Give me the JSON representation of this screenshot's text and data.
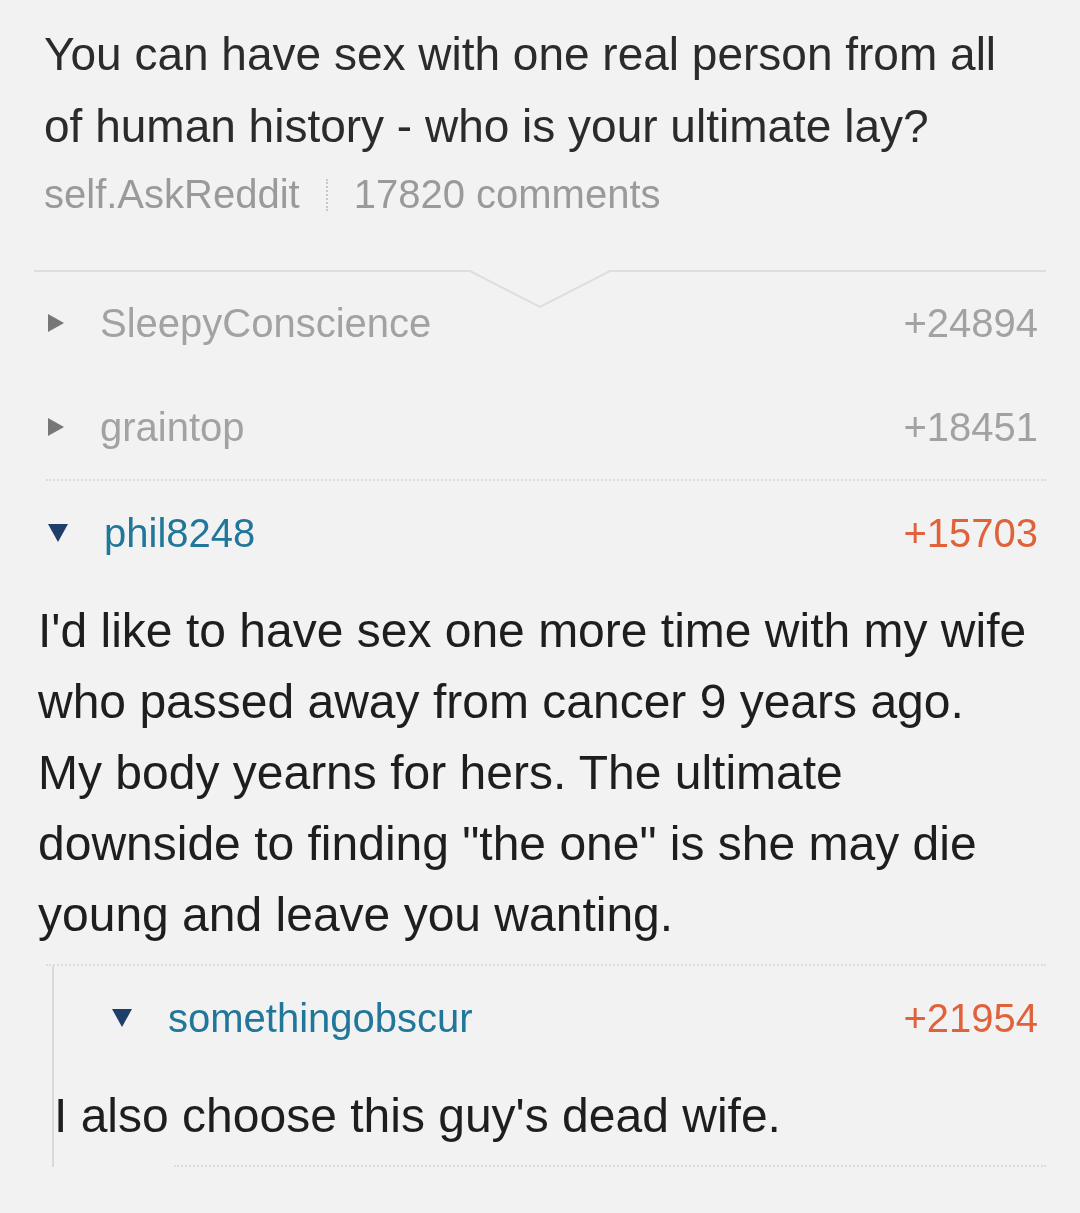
{
  "post": {
    "title": "You can have sex with one real person from all of human history - who is your ultimate lay?",
    "subreddit": "self.AskReddit",
    "comments": "17820 comments"
  },
  "comments": [
    {
      "author": "SleepyConscience",
      "score": "+24894",
      "expanded": false
    },
    {
      "author": "graintop",
      "score": "+18451",
      "expanded": false
    },
    {
      "author": "phil8248",
      "score": "+15703",
      "expanded": true,
      "body": "I'd like to have sex one more time with my wife who passed away from cancer 9 years ago. My body yearns for hers.  The ultimate downside to finding \"the one\" is she may die young and leave you wanting.",
      "replies": [
        {
          "author": "somethingobscur",
          "score": "+21954",
          "expanded": true,
          "body": "I also choose this guy's dead wife."
        }
      ]
    }
  ]
}
